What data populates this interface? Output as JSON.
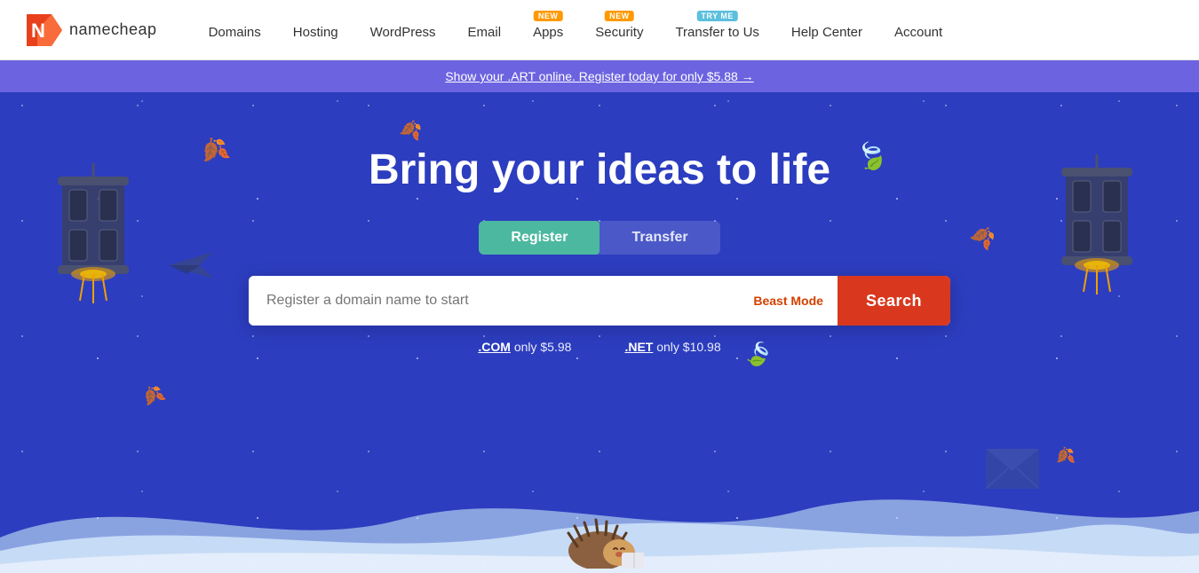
{
  "navbar": {
    "logo_text": "namecheap",
    "nav_items": [
      {
        "id": "domains",
        "label": "Domains",
        "badge": null
      },
      {
        "id": "hosting",
        "label": "Hosting",
        "badge": null
      },
      {
        "id": "wordpress",
        "label": "WordPress",
        "badge": null
      },
      {
        "id": "email",
        "label": "Email",
        "badge": null
      },
      {
        "id": "apps",
        "label": "Apps",
        "badge": "NEW",
        "badge_type": "new"
      },
      {
        "id": "security",
        "label": "Security",
        "badge": "NEW",
        "badge_type": "new"
      },
      {
        "id": "transfer",
        "label": "Transfer to Us",
        "badge": "TRY ME",
        "badge_type": "tryme"
      },
      {
        "id": "help",
        "label": "Help Center",
        "badge": null
      },
      {
        "id": "account",
        "label": "Account",
        "badge": null
      }
    ]
  },
  "promo_banner": {
    "text": "Show your .ART online. Register today for only $5.88 →",
    "link": "#"
  },
  "hero": {
    "title": "Bring your ideas to life",
    "tabs": [
      {
        "id": "register",
        "label": "Register",
        "active": true
      },
      {
        "id": "transfer",
        "label": "Transfer",
        "active": false
      }
    ],
    "search": {
      "placeholder": "Register a domain name to start",
      "beast_mode_label": "Beast Mode",
      "button_label": "Search"
    },
    "price_hints": [
      {
        "tld": ".COM",
        "text": "only $5.98"
      },
      {
        "tld": ".NET",
        "text": "only $10.98"
      }
    ]
  }
}
